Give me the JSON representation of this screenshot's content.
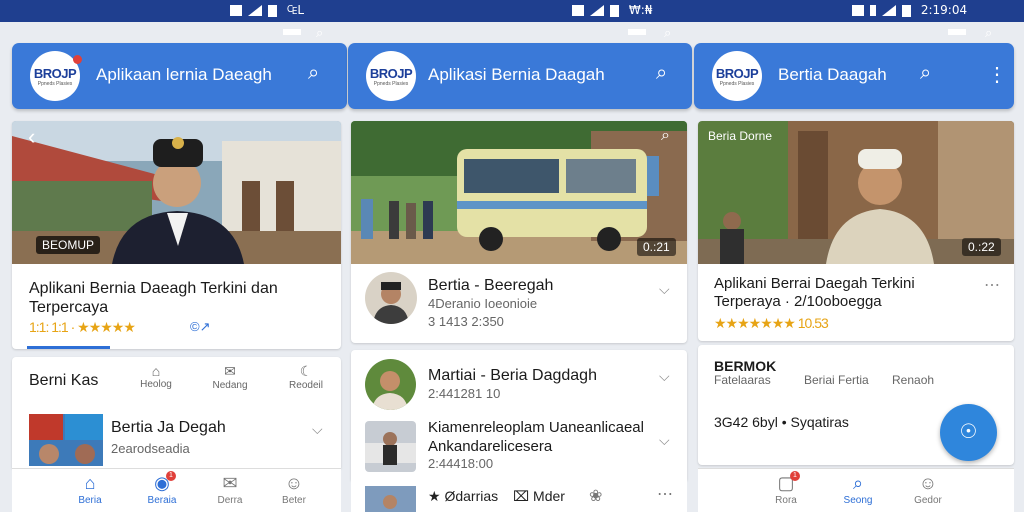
{
  "status_bars": [
    {
      "text": "◉ ◎ ▐ ▐ ₠ Iı Iı",
      "time": "₠L"
    },
    {
      "text": "◉ ◎ ▐",
      "time": "₩:₦"
    },
    {
      "text": "◉ ✱ ◎ ▐",
      "time": "2:19:04"
    }
  ],
  "panels": [
    {
      "logo": {
        "text": "BROJP",
        "sub": "Ppneds Plasies"
      },
      "title": "Aplikaan lernia Daeagh",
      "hero": {
        "tag": "BEOMUP",
        "back": "‹"
      },
      "headline": "Aplikani Bernia Daeagh Terkini dan Terpercaya",
      "rating": "1:1: 1:1 · ★★★★★",
      "share": "©↗",
      "sectionTitle": "Berni Kas",
      "sectionTabs": [
        "Heolog",
        "Nedang",
        "Reodeil"
      ],
      "item": {
        "title": "Bertia Ja Degah",
        "meta": "2earodseadia"
      },
      "nav": [
        {
          "label": "Beria",
          "icon": "⌂",
          "active": true
        },
        {
          "label": "Beraia",
          "icon": "◉",
          "active": true,
          "badge": "1"
        },
        {
          "label": "Derra",
          "icon": "✉",
          "active": false
        },
        {
          "label": "Beter",
          "icon": "☺",
          "active": false
        }
      ]
    },
    {
      "logo": {
        "text": "BROJP",
        "sub": "Ppneds Plasies"
      },
      "title": "Aplikasi Bernia Daagah",
      "hero": {
        "duration": "0.:21"
      },
      "items": [
        {
          "title": "Bertia - Beeregah",
          "line1": "4Deranio Ioeonioie",
          "line2": "3 1413 2:350"
        },
        {
          "title": "Martiai - Beria Dagdagh",
          "line1": "2:441281 10",
          "line2": ""
        },
        {
          "title": "Kiamenreleoplam Uaneanlicaeal Ankandarelicesera",
          "line1": "2:44418:00",
          "line2": ""
        }
      ],
      "bottomStrip": [
        {
          "label": "Ødarrias",
          "icon": "★"
        },
        {
          "label": "Mder",
          "icon": "⌧"
        },
        {
          "label": "",
          "icon": "❀"
        }
      ]
    },
    {
      "logo": {
        "text": "BROJP",
        "sub": "Ppneds Plasies"
      },
      "title": "Bertia Daagah",
      "hero": {
        "tag": "Beria Dorne",
        "duration": "0.:22"
      },
      "headline": "Aplikani Berrai Daegah Terkini Terperaya · 2/10oboegga",
      "rating": "★★★★★★★ 10.53",
      "section": {
        "title": "BERMOK",
        "tabs": [
          "Fatelaaras",
          "Beriai Fertia",
          "Renaoh"
        ]
      },
      "footnote": "3G42 6byl • Syqatiras",
      "nav": [
        {
          "label": "Rora",
          "icon": "▢",
          "active": false,
          "badge": "1"
        },
        {
          "label": "Seong",
          "icon": "⌕",
          "active": true
        },
        {
          "label": "Gedor",
          "icon": "☺",
          "active": false
        }
      ],
      "fab": "☉"
    }
  ],
  "colors": {
    "statusbar": "#1f3f8f",
    "appbar": "#3a79d8",
    "accent": "#2e6fd6",
    "star": "#e7a415",
    "badge": "#e0403a"
  },
  "icons": {
    "search": "search-icon",
    "more": "more-vert-icon",
    "back": "back-icon",
    "chevron": "chevron-down-icon"
  }
}
